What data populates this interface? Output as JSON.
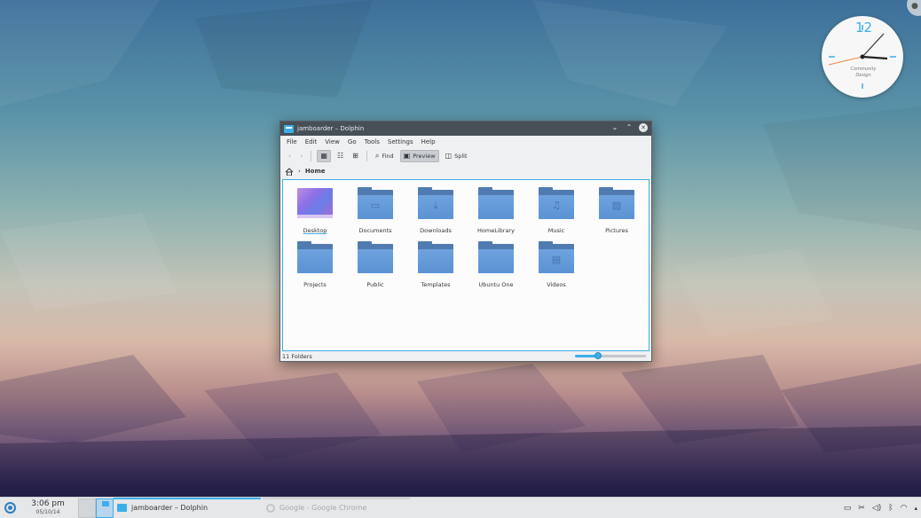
{
  "desktop": {
    "clock_widget": {
      "hour_label": "12",
      "caption_line1": "Community",
      "caption_line2": "Design"
    }
  },
  "window": {
    "title": "jamboarder – Dolphin",
    "controls": {
      "minimize": "⌄",
      "maximize": "⌃",
      "close": "✕"
    },
    "menu": [
      "File",
      "Edit",
      "View",
      "Go",
      "Tools",
      "Settings",
      "Help"
    ],
    "toolbar": {
      "find_label": "Find",
      "preview_label": "Preview",
      "split_label": "Split"
    },
    "breadcrumb": {
      "separator": "›",
      "current": "Home"
    },
    "items": [
      {
        "name": "Desktop",
        "icon": "desktop-thumbnail"
      },
      {
        "name": "Documents",
        "icon": "folder-documents-icon"
      },
      {
        "name": "Downloads",
        "icon": "folder-downloads-icon"
      },
      {
        "name": "HomeLibrary",
        "icon": "folder-icon"
      },
      {
        "name": "Music",
        "icon": "folder-music-icon"
      },
      {
        "name": "Pictures",
        "icon": "folder-pictures-icon"
      },
      {
        "name": "Projects",
        "icon": "folder-icon"
      },
      {
        "name": "Public",
        "icon": "folder-icon"
      },
      {
        "name": "Templates",
        "icon": "folder-icon"
      },
      {
        "name": "Ubuntu One",
        "icon": "folder-icon"
      },
      {
        "name": "Videos",
        "icon": "folder-videos-icon"
      }
    ],
    "status": {
      "text": "11 Folders",
      "zoom_level": 0.33
    }
  },
  "panel": {
    "time": "3:06 pm",
    "date": "05/10/14",
    "tasks": [
      {
        "label": "jamboarder – Dolphin",
        "state": "active"
      },
      {
        "label": "Google - Google Chrome",
        "state": "inactive"
      }
    ],
    "tray_icons": [
      "notes-icon",
      "tools-icon",
      "volume-icon",
      "bluetooth-icon",
      "wifi-icon",
      "expand-arrow-icon"
    ]
  },
  "colors": {
    "accent": "#3daee9",
    "folder": "#5b92d3",
    "titlebar": "#475057"
  }
}
